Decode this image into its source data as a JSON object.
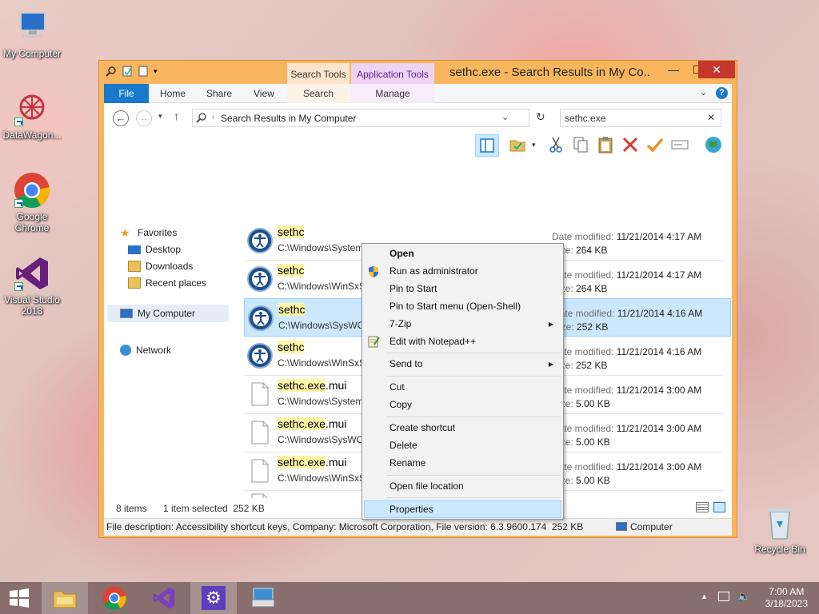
{
  "desktop": {
    "icons": [
      {
        "label": "My Computer"
      },
      {
        "label": "DataWagon..."
      },
      {
        "label": "Google Chrome"
      },
      {
        "label": "Visual Studio 2013"
      },
      {
        "label": "Recycle Bin"
      }
    ]
  },
  "window": {
    "title": "sethc.exe - Search Results in My Co...",
    "context_tabs": {
      "search_tools": "Search Tools",
      "application_tools": "Application Tools"
    },
    "ribbon_tabs": [
      "File",
      "Home",
      "Share",
      "View",
      "Search",
      "Manage"
    ],
    "address": "Search Results in My Computer",
    "search_value": "sethc.exe"
  },
  "nav": {
    "favorites": "Favorites",
    "desktop": "Desktop",
    "downloads": "Downloads",
    "recent": "Recent places",
    "computer": "My Computer",
    "network": "Network"
  },
  "meta_labels": {
    "date_modified": "Date modified:",
    "size": "Size:"
  },
  "files": [
    {
      "name_hl": "sethc",
      "name_rest": "",
      "path": "C:\\Windows\\System32",
      "date": "11/21/2014 4:17 AM",
      "size": "264 KB"
    },
    {
      "name_hl": "sethc",
      "name_rest": "",
      "path": "C:\\Windows\\WinSxS\\amd64_microsoft-windows-sethc_31bf...",
      "date": "11/21/2014 4:17 AM",
      "size": "264 KB"
    },
    {
      "name_hl": "sethc",
      "name_rest": "",
      "path": "C:\\Windows\\SysWOW64",
      "date": "11/21/2014 4:16 AM",
      "size": "252 KB"
    },
    {
      "name_hl": "sethc",
      "name_rest": "",
      "path": "C:\\Windows\\WinSxS\\wow64_microsoft",
      "date": "11/21/2014 4:16 AM",
      "size": "252 KB"
    },
    {
      "name_hl": "sethc.exe",
      "name_rest": ".mui",
      "path": "C:\\Windows\\System32\\en-US",
      "date": "11/21/2014 3:00 AM",
      "size": "5.00 KB"
    },
    {
      "name_hl": "sethc.exe",
      "name_rest": ".mui",
      "path": "C:\\Windows\\SysWOW64\\en-US",
      "date": "11/21/2014 3:00 AM",
      "size": "5.00 KB"
    },
    {
      "name_hl": "sethc.exe",
      "name_rest": ".mui",
      "path": "C:\\Windows\\WinSxS\\amd64",
      "date": "11/21/2014 3:00 AM",
      "size": "5.00 KB"
    },
    {
      "name_hl": "sethc.exe",
      "name_rest": ".mui",
      "path": "C:\\Windows\\WinSxS\\wow64",
      "date": "11/21/2014 3:00 AM",
      "size": "5.00 KB"
    }
  ],
  "status": {
    "items": "8 items",
    "selected": "1 item selected  252 KB",
    "details": "File description: Accessibility shortcut keys, Company: Microsoft Corporation, File version: 6.3.9600.174  252 KB",
    "location": "Computer"
  },
  "context_menu": {
    "open": "Open",
    "run_admin": "Run as administrator",
    "pin_start": "Pin to Start",
    "pin_start_menu": "Pin to Start menu (Open-Shell)",
    "zip": "7-Zip",
    "notepad": "Edit with Notepad++",
    "send_to": "Send to",
    "cut": "Cut",
    "copy": "Copy",
    "create_shortcut": "Create shortcut",
    "delete": "Delete",
    "rename": "Rename",
    "open_location": "Open file location",
    "properties": "Properties"
  },
  "clock": {
    "time": "7:00 AM",
    "date": "3/18/2023"
  },
  "colors": {
    "accent": "#1979ca",
    "title_bar": "#f7b65e",
    "selection": "#cce8ff",
    "highlight": "#fff6a8"
  }
}
